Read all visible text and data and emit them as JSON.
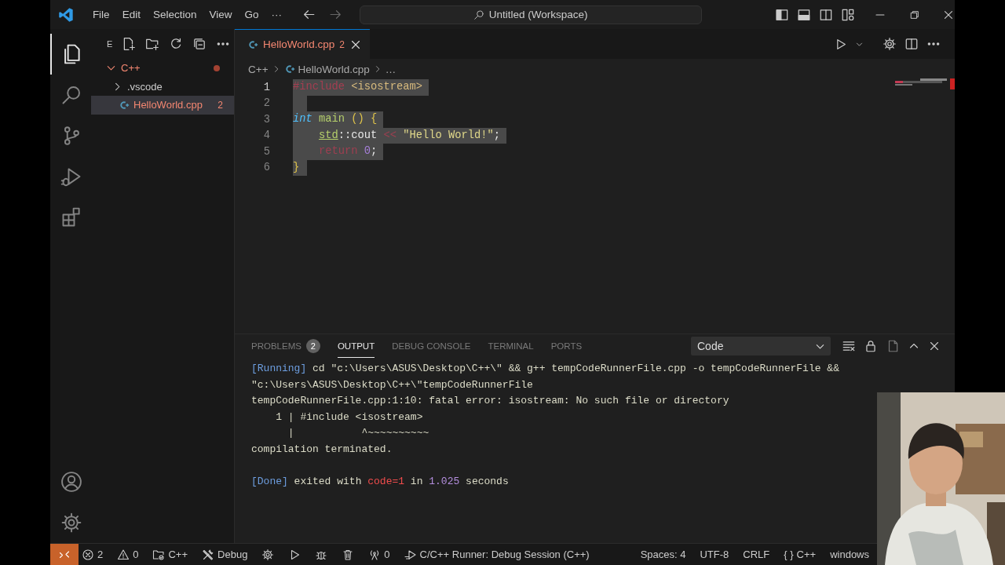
{
  "title_bar": {
    "menu": [
      "File",
      "Edit",
      "Selection",
      "View",
      "Go",
      "···"
    ],
    "search": "Untitled (Workspace)"
  },
  "activity_bar": {
    "items": [
      {
        "selected": true
      },
      {
        "selected": false
      },
      {
        "selected": false
      },
      {
        "selected": false
      },
      {
        "selected": false
      }
    ]
  },
  "sidebar": {
    "header": "E",
    "tree": [
      {
        "label": "C++",
        "kind": "folder",
        "expanded": true,
        "error": true,
        "modified": true,
        "selected": false,
        "children": [
          {
            "label": ".vscode",
            "kind": "folder",
            "expanded": false,
            "error": false,
            "modified": false,
            "selected": false
          },
          {
            "label": "HelloWorld.cpp",
            "kind": "file",
            "badge": "2",
            "error": true,
            "modified": false,
            "selected": true
          }
        ]
      }
    ]
  },
  "editor": {
    "tabs": [
      {
        "label": "HelloWorld.cpp",
        "badge": "2",
        "error": true,
        "selected": true
      }
    ],
    "breadcrumb": [
      "C++",
      "HelloWorld.cpp",
      "…"
    ],
    "lines": [
      {
        "number": "1",
        "selected": true,
        "indented": false,
        "tokens": [
          {
            "text": "#include",
            "kind": "directive"
          },
          {
            "text": " <isostream>",
            "kind": "header"
          }
        ]
      },
      {
        "number": "2",
        "selected": true,
        "indented": false
      },
      {
        "number": "3",
        "selected": true,
        "indented": false,
        "tokens": [
          {
            "text": "int",
            "kind": "keyword"
          },
          {
            "text": " main",
            "kind": "function"
          },
          {
            "text": " () {",
            "kind": "bracket"
          }
        ]
      },
      {
        "number": "4",
        "selected": true,
        "indented": true,
        "tokens": [
          {
            "text": "std",
            "kind": "namespace"
          },
          {
            "text": "::cout",
            "kind": "plain"
          },
          {
            "text": " <<",
            "kind": "operator"
          },
          {
            "text": " \"Hello World!\"",
            "kind": "string"
          },
          {
            "text": ";",
            "kind": "plain"
          }
        ]
      },
      {
        "number": "5",
        "selected": true,
        "indented": true,
        "tokens": [
          {
            "text": "return",
            "kind": "control"
          },
          {
            "text": " 0",
            "kind": "number"
          },
          {
            "text": ";",
            "kind": "plain"
          }
        ]
      },
      {
        "number": "6",
        "selected": true,
        "indented": false,
        "tokens": [
          {
            "text": "}",
            "kind": "bracket"
          }
        ]
      }
    ]
  },
  "panel": {
    "tabs": [
      {
        "label": "PROBLEMS",
        "badge": "2",
        "selected": false
      },
      {
        "label": "OUTPUT",
        "selected": true
      },
      {
        "label": "DEBUG CONSOLE",
        "selected": false
      },
      {
        "label": "TERMINAL",
        "selected": false
      },
      {
        "label": "PORTS",
        "selected": false
      }
    ],
    "channel": "Code",
    "output": [
      {
        "spaced": false,
        "segments": [
          {
            "text": "[Running]",
            "kind": "tag"
          },
          {
            "text": " cd \"c:\\Users\\ASUS\\Desktop\\C++\\\" && g++ tempCodeRunnerFile.cpp -o tempCodeRunnerFile &&",
            "kind": "plain"
          }
        ]
      },
      {
        "spaced": false,
        "segments": [
          {
            "text": "\"c:\\Users\\ASUS\\Desktop\\C++\\\"tempCodeRunnerFile",
            "kind": "plain"
          }
        ]
      },
      {
        "spaced": false,
        "segments": [
          {
            "text": "tempCodeRunnerFile.cpp:1:10: fatal error: isostream: No such file or directory",
            "kind": "plain"
          }
        ]
      },
      {
        "spaced": false,
        "segments": [
          {
            "text": "    1 | #include <isostream>",
            "kind": "plain"
          }
        ]
      },
      {
        "spaced": false,
        "segments": [
          {
            "text": "      |           ^~~~~~~~~~~",
            "kind": "plain"
          }
        ]
      },
      {
        "spaced": false,
        "segments": [
          {
            "text": "compilation terminated.",
            "kind": "plain"
          }
        ]
      },
      {
        "spaced": true,
        "segments": [
          {
            "text": "[Done]",
            "kind": "tag"
          },
          {
            "text": " exited with ",
            "kind": "plain"
          },
          {
            "text": "code=1",
            "kind": "error"
          },
          {
            "text": " in ",
            "kind": "plain"
          },
          {
            "text": "1.025",
            "kind": "number"
          },
          {
            "text": " seconds",
            "kind": "plain"
          }
        ]
      }
    ]
  },
  "status_bar": {
    "left": [
      {
        "kind": "remote"
      },
      {
        "kind": "errors",
        "text": "2"
      },
      {
        "kind": "warnings",
        "text": "0"
      },
      {
        "kind": "folder",
        "text": "C++"
      },
      {
        "kind": "build",
        "text": "Debug"
      },
      {
        "kind": "settings"
      },
      {
        "kind": "run"
      },
      {
        "kind": "debug"
      },
      {
        "kind": "clean"
      },
      {
        "kind": "ports",
        "text": "0"
      },
      {
        "kind": "runner",
        "text": "C/C++ Runner: Debug Session (C++)"
      }
    ],
    "right": [
      {
        "kind": "text",
        "text": "Spaces: 4"
      },
      {
        "kind": "text",
        "text": "UTF-8"
      },
      {
        "kind": "text",
        "text": "CRLF"
      },
      {
        "kind": "language",
        "icon": "{ }",
        "text": "C++"
      },
      {
        "kind": "text",
        "text": "windows"
      }
    ]
  }
}
